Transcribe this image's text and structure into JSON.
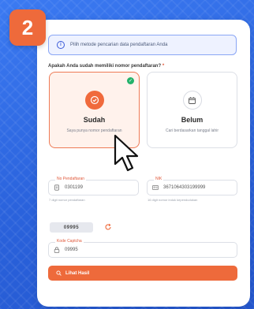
{
  "step": {
    "number": "2"
  },
  "info_banner": {
    "text": "Pilih metode pencarian data pendaftaran Anda"
  },
  "question": {
    "label": "Apakah Anda sudah memiliki nomor pendaftaran?",
    "required_mark": "*"
  },
  "options": [
    {
      "title": "Sudah",
      "subtitle": "Saya punya nomor pendaftaran",
      "selected": true,
      "icon": "check-circle-icon"
    },
    {
      "title": "Belum",
      "subtitle": "Cari berdasarkan tanggal lahir",
      "selected": false,
      "icon": "calendar-icon"
    }
  ],
  "fields": {
    "registration_number": {
      "label": "No Pendaftaran",
      "value": "0301199",
      "hint": "7 digit nomor pendaftaran"
    },
    "nik": {
      "label": "NIK",
      "value": "3671064303199999",
      "hint": "16 digit nomor induk kependudukan"
    },
    "captcha_code": {
      "label": "Kode Captcha",
      "value": "09995"
    }
  },
  "captcha": {
    "image_text": "09995"
  },
  "submit": {
    "label": "Lihat Hasil"
  },
  "colors": {
    "accent": "#ee6a3b",
    "background": "#2f6fe6",
    "success": "#23b26b"
  }
}
